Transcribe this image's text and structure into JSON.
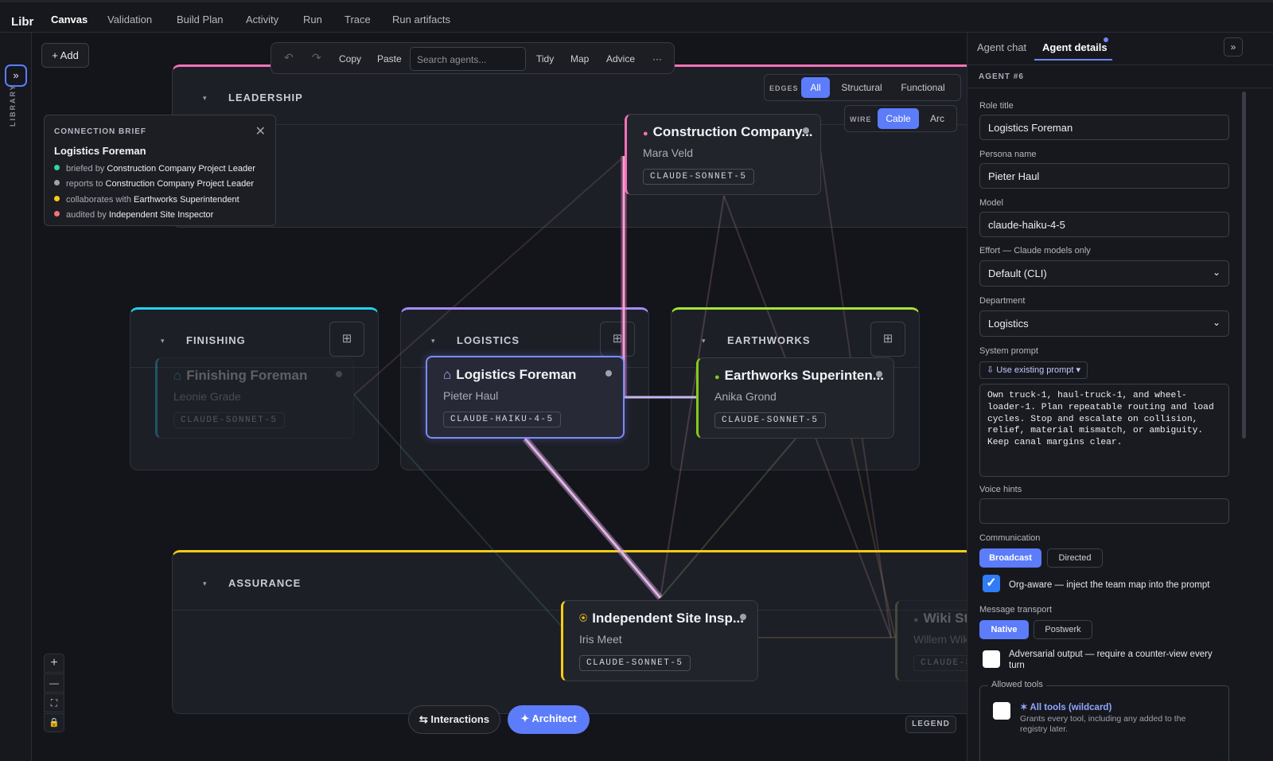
{
  "app": {
    "brand": "Libr",
    "library_label": "LIBRARY",
    "rail_toggle": "»"
  },
  "nav": {
    "tabs": [
      "Canvas",
      "Validation",
      "Build Plan",
      "Activity",
      "Run",
      "Trace",
      "Run artifacts"
    ],
    "active": "Canvas"
  },
  "canvas": {
    "add_label": "+ Add",
    "toolbar": {
      "undo": "↶",
      "redo": "↷",
      "copy": "Copy",
      "paste": "Paste",
      "search_placeholder": "Search agents...",
      "tidy": "Tidy",
      "map": "Map",
      "advice": "Advice",
      "more": "···"
    },
    "edges": {
      "label": "EDGES",
      "options": [
        "All",
        "Structural",
        "Functional"
      ],
      "selected": "All"
    },
    "wire": {
      "label": "WIRE",
      "options": [
        "Cable",
        "Arc"
      ],
      "selected": "Cable"
    },
    "brief": {
      "heading": "CONNECTION BRIEF",
      "close": "✕",
      "title": "Logistics Foreman",
      "rows": [
        {
          "verb": "briefed by",
          "target": "Construction Company Project Leader",
          "color": "#34d399"
        },
        {
          "verb": "reports to",
          "target": "Construction Company Project Leader",
          "color": "#9ca3af"
        },
        {
          "verb": "collaborates with",
          "target": "Earthworks Superintendent",
          "color": "#facc15"
        },
        {
          "verb": "audited by",
          "target": "Independent Site Inspector",
          "color": "#f87171"
        }
      ]
    },
    "groups": {
      "leadership": {
        "title": "LEADERSHIP",
        "color": "#f472b6"
      },
      "finishing": {
        "title": "FINISHING",
        "color": "#22d3ee"
      },
      "logistics": {
        "title": "LOGISTICS",
        "color": "#a78bfa"
      },
      "earthworks": {
        "title": "EARTHWORKS",
        "color": "#a3e635"
      },
      "assurance": {
        "title": "ASSURANCE",
        "color": "#facc15"
      }
    },
    "group_caret": "▾",
    "group_icon": "⊞",
    "nodes": {
      "construction": {
        "title": "Construction Company...",
        "persona": "Mara Veld",
        "model": "CLAUDE-SONNET-5",
        "glyph": "●",
        "color": "#f472b6"
      },
      "finishing": {
        "title": "Finishing Foreman",
        "persona": "Leonie Grade",
        "model": "CLAUDE-SONNET-5",
        "glyph": "⌂",
        "color": "#22d3ee"
      },
      "logistics": {
        "title": "Logistics Foreman",
        "persona": "Pieter Haul",
        "model": "CLAUDE-HAIKU-4-5",
        "glyph": "⌂",
        "color": "#818cf8"
      },
      "earthworks": {
        "title": "Earthworks Superinten...",
        "persona": "Anika Grond",
        "model": "CLAUDE-SONNET-5",
        "glyph": "●",
        "color": "#84cc16"
      },
      "inspector": {
        "title": "Independent Site Insp...",
        "persona": "Iris Meet",
        "model": "CLAUDE-SONNET-5",
        "glyph": "⍟",
        "color": "#facc15"
      },
      "wiki": {
        "title": "Wiki Ste",
        "persona": "Willem Wik",
        "model": "CLAUDE-SO",
        "glyph": "●",
        "color": "#a3a36b"
      }
    },
    "zoom": {
      "in": "+",
      "out": "—",
      "fit": "⛶",
      "lock": "🔒"
    },
    "interactions_label": "⇆ Interactions",
    "architect_label": "✦ Architect",
    "legend_label": "LEGEND"
  },
  "panel": {
    "tabs": [
      "Agent chat",
      "Agent details"
    ],
    "active": "Agent details",
    "collapse": "»",
    "section": "AGENT #6",
    "role_label": "Role title",
    "role_value": "Logistics Foreman",
    "persona_label": "Persona name",
    "persona_value": "Pieter Haul",
    "model_label": "Model",
    "model_value": "claude-haiku-4-5",
    "effort_label": "Effort — Claude models only",
    "effort_value": "Default (CLI)",
    "dept_label": "Department",
    "dept_value": "Logistics",
    "prompt_label": "System prompt",
    "prompt_source": "⇩ Use existing prompt ▾",
    "prompt_text": "Own truck-1, haul-truck-1, and wheel-\nloader-1. Plan repeatable routing and load\ncycles. Stop and escalate on collision,\nrelief, material mismatch, or ambiguity.\nKeep canal margins clear.",
    "voice_label": "Voice hints",
    "voice_value": "",
    "comm_label": "Communication",
    "comm_options": [
      "Broadcast",
      "Directed"
    ],
    "comm_selected": "Broadcast",
    "org_aware_label": "Org-aware — inject the team map into the prompt",
    "org_aware_checked": true,
    "transport_label": "Message transport",
    "transport_options": [
      "Native",
      "Postwerk"
    ],
    "transport_selected": "Native",
    "adversarial_label": "Adversarial output — require a counter-view every turn",
    "adversarial_checked": false,
    "tools_label": "Allowed tools",
    "tool_wildcard": "✶ All tools (wildcard)",
    "tool_wildcard_desc": "Grants every tool, including any added to the registry later.",
    "tool_wildcard_checked": false,
    "check_mark": "✓"
  }
}
